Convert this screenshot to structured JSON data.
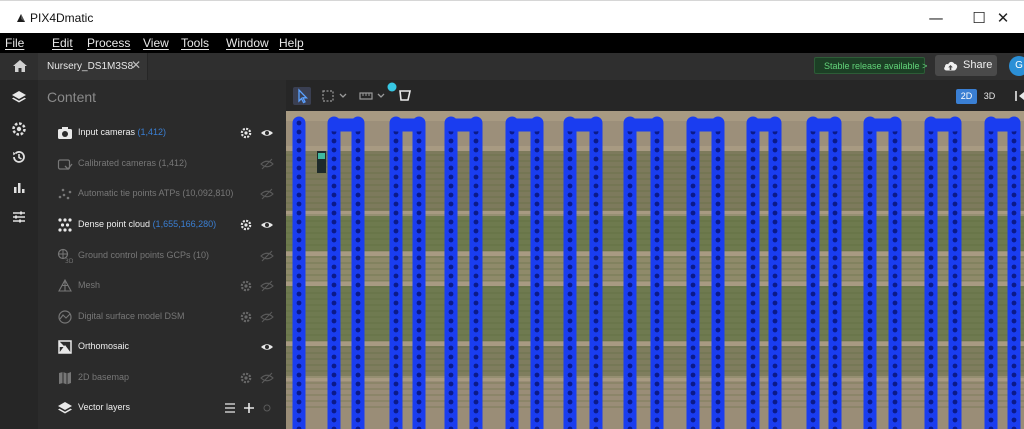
{
  "window": {
    "title": "PIX4Dmatic",
    "minimize_glyph": "—",
    "maximize_glyph": "☐",
    "close_glyph": "✕"
  },
  "menu": [
    "File",
    "Edit",
    "Process",
    "View",
    "Tools",
    "Window",
    "Help"
  ],
  "tabbar": {
    "tab_label": "Nursery_DS1M3S8",
    "tab_close": "✕",
    "release_badge": "Stable release available  >",
    "share_label": "Share",
    "avatar_initial": "G"
  },
  "panel": {
    "title": "Content",
    "layers": [
      {
        "label": "Input cameras ",
        "count": "(1,412)",
        "icon": "camera-icon",
        "active": true,
        "settings": true,
        "visible": true
      },
      {
        "label": "Calibrated cameras (1,412)",
        "count": "",
        "icon": "calibrated-camera-icon",
        "active": false,
        "settings": false,
        "visible": false
      },
      {
        "label": "Automatic tie points ATPs (10,092,810)",
        "count": "",
        "icon": "tie-points-icon",
        "active": false,
        "settings": false,
        "visible": false
      },
      {
        "label": "Dense point cloud ",
        "count": "(1,655,166,280)",
        "icon": "point-cloud-icon",
        "active": true,
        "settings": true,
        "visible": true
      },
      {
        "label": "Ground control points GCPs (10)",
        "count": "",
        "icon": "gcp-icon",
        "active": false,
        "settings": false,
        "visible": false
      },
      {
        "label": "Mesh",
        "count": "",
        "icon": "mesh-icon",
        "active": false,
        "settings": true,
        "visible": false
      },
      {
        "label": "Digital surface model DSM",
        "count": "",
        "icon": "dsm-icon",
        "active": false,
        "settings": true,
        "visible": false
      },
      {
        "label": "Orthomosaic",
        "count": "",
        "icon": "orthomosaic-icon",
        "active": true,
        "settings": false,
        "visible": true
      },
      {
        "label": "2D basemap",
        "count": "",
        "icon": "basemap-icon",
        "active": false,
        "settings": true,
        "visible": false
      },
      {
        "label": "Vector layers",
        "count": "",
        "icon": "vector-layers-icon",
        "active": true,
        "settings": false,
        "visible": false
      }
    ]
  },
  "viewer": {
    "view_2d": "2D",
    "view_3d": "3D"
  },
  "colors": {
    "accent": "#3a7fd3",
    "camera_marker": "#1a3df0",
    "release_green": "#63d47a"
  }
}
